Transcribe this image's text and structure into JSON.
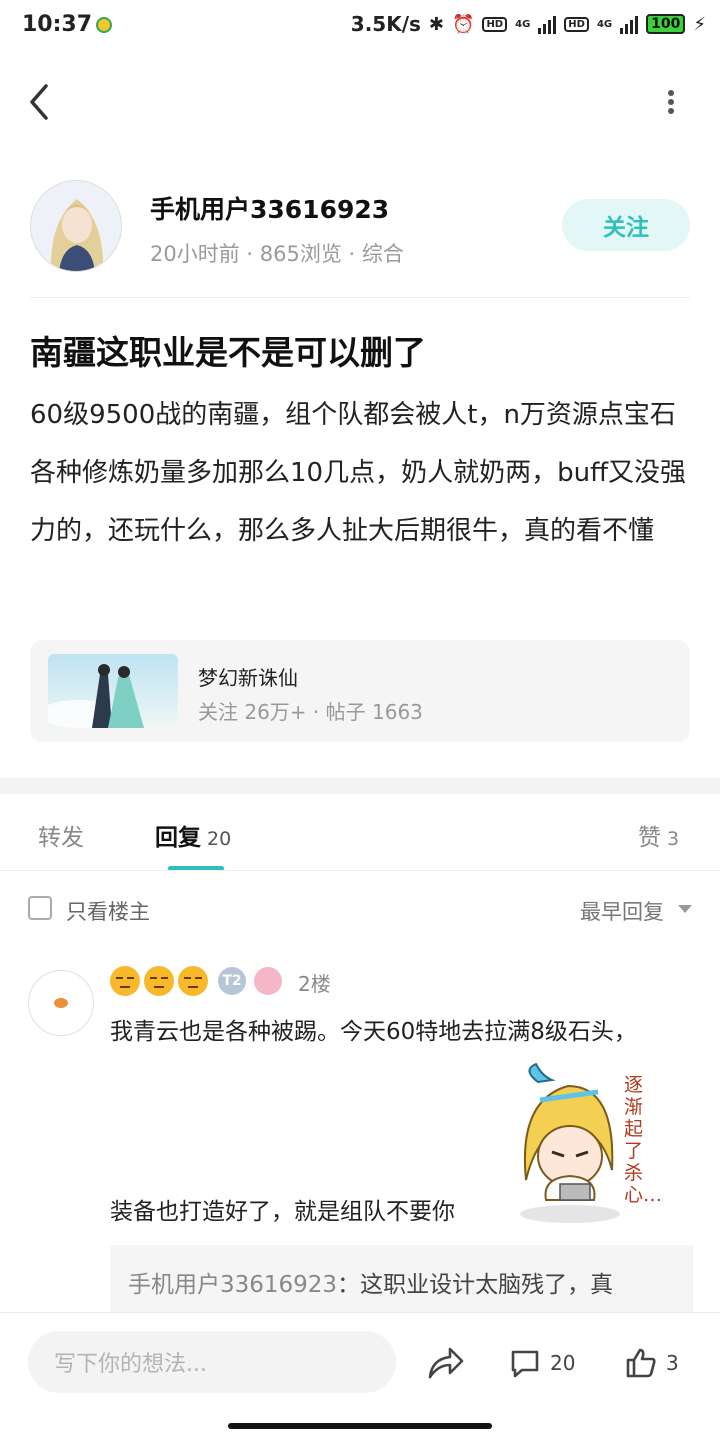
{
  "status_bar": {
    "time": "10:37",
    "net_speed": "3.5K/s",
    "hd1": "HD",
    "net1": "4G",
    "hd2": "HD",
    "net2": "4G",
    "battery": "100"
  },
  "author": {
    "name": "手机用户33616923",
    "meta": "20小时前 · 865浏览 · 综合",
    "follow_label": "关注"
  },
  "post": {
    "title": "南疆这职业是不是可以删了",
    "body": "60级9500战的南疆，组个队都会被人t，n万资源点宝石各种修炼奶量多加那么10几点，奶人就奶两，buff又没强力的，还玩什么，那么多人扯大后期很牛，真的看不懂"
  },
  "forum": {
    "name": "梦幻新诛仙",
    "stats": "关注 26万+ · 帖子 1663"
  },
  "tabs": {
    "forward": "转发",
    "reply": "回复",
    "reply_count": "20",
    "like": "赞",
    "like_count": "3"
  },
  "filter": {
    "owner_only": "只看楼主",
    "sort": "最早回复"
  },
  "comment": {
    "level": "T2",
    "floor": "2楼",
    "line1": "我青云也是各种被踢。今天60特地去拉满8级石头，",
    "line2": "装备也打造好了，就是组队不要你",
    "sticker_text": "逐渐起了杀心…",
    "quote_user": "手机用户33616923",
    "quote_text": "：这职业设计太脑残了，真"
  },
  "bottom": {
    "input_placeholder": "写下你的想法...",
    "comment_count": "20",
    "like_count": "3"
  },
  "colors": {
    "accent": "#2fc0bd",
    "follow_bg": "#e2f7f6"
  }
}
